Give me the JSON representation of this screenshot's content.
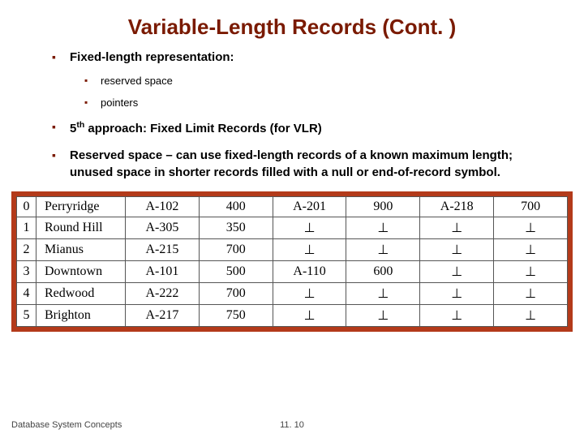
{
  "title": "Variable-Length Records (Cont. )",
  "bullets": {
    "b1": "Fixed-length representation:",
    "b1a": "reserved space",
    "b1b": "pointers",
    "b2_pre": "5",
    "b2_sup": "th",
    "b2_post": " approach: Fixed Limit Records (for VLR)",
    "b3": "Reserved space – can use fixed-length records of a known maximum length; unused space in shorter records filled with a null or end-of-record symbol."
  },
  "table": {
    "perp_symbol": "⊥",
    "rows": [
      {
        "idx": "0",
        "name": "Perryridge",
        "c1": "A-102",
        "v1": "400",
        "c2": "A-201",
        "v2": "900",
        "c3": "A-218",
        "v3": "700"
      },
      {
        "idx": "1",
        "name": "Round Hill",
        "c1": "A-305",
        "v1": "350",
        "c2": "⊥",
        "v2": "⊥",
        "c3": "⊥",
        "v3": "⊥"
      },
      {
        "idx": "2",
        "name": "Mianus",
        "c1": "A-215",
        "v1": "700",
        "c2": "⊥",
        "v2": "⊥",
        "c3": "⊥",
        "v3": "⊥"
      },
      {
        "idx": "3",
        "name": "Downtown",
        "c1": "A-101",
        "v1": "500",
        "c2": "A-110",
        "v2": "600",
        "c3": "⊥",
        "v3": "⊥"
      },
      {
        "idx": "4",
        "name": "Redwood",
        "c1": "A-222",
        "v1": "700",
        "c2": "⊥",
        "v2": "⊥",
        "c3": "⊥",
        "v3": "⊥"
      },
      {
        "idx": "5",
        "name": "Brighton",
        "c1": "A-217",
        "v1": "750",
        "c2": "⊥",
        "v2": "⊥",
        "c3": "⊥",
        "v3": "⊥"
      }
    ]
  },
  "footer": {
    "left": "Database System Concepts",
    "center": "11. 10"
  }
}
